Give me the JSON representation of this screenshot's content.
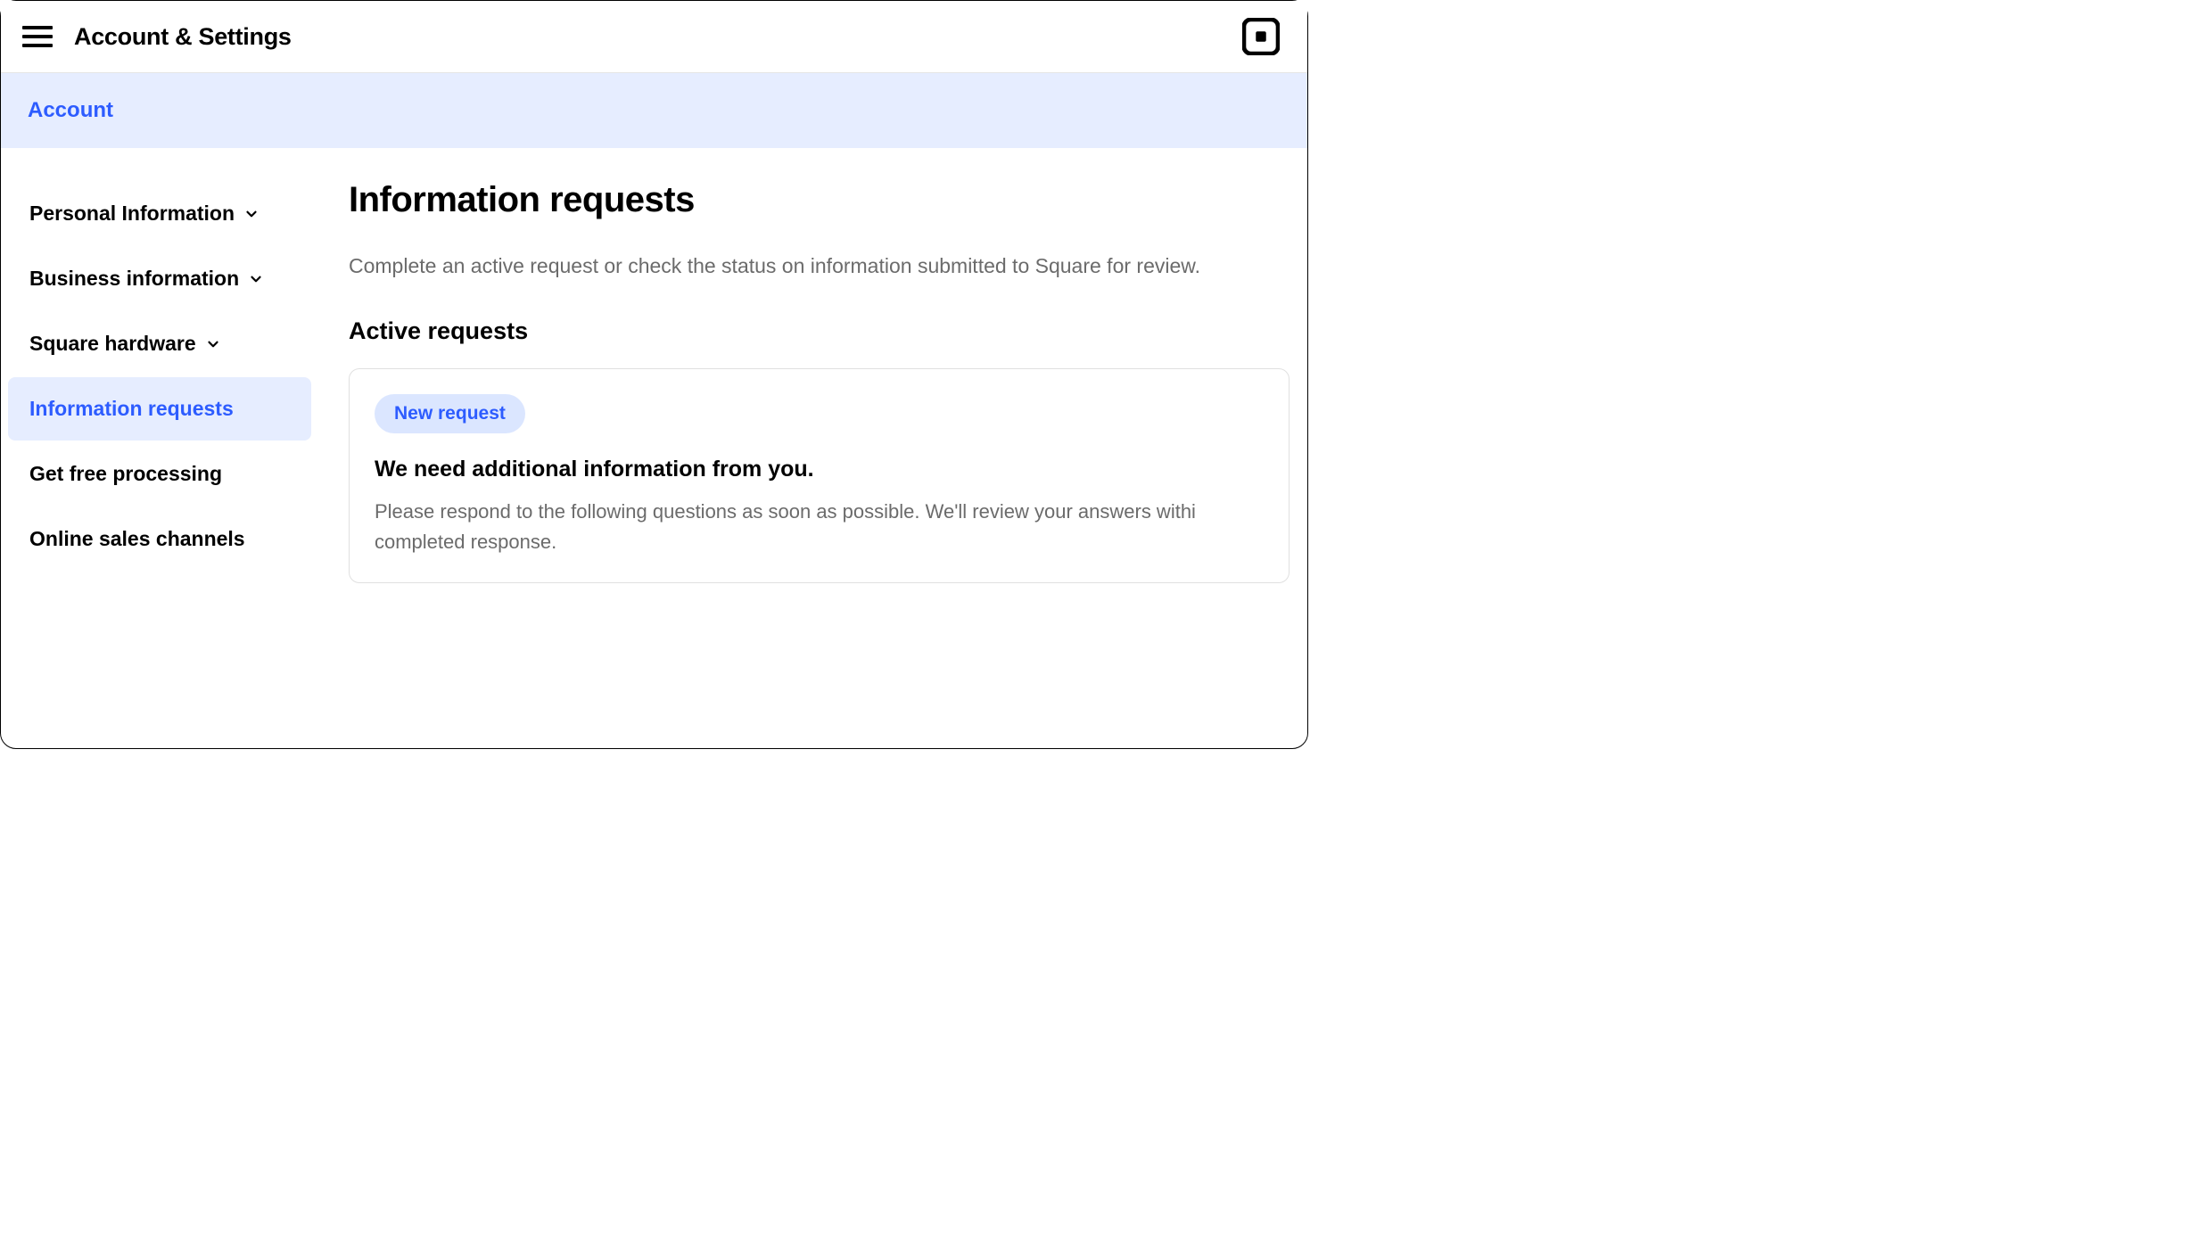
{
  "header": {
    "title": "Account & Settings"
  },
  "tabs": {
    "account": "Account"
  },
  "sidebar": {
    "items": [
      {
        "label": "Personal Information",
        "hasChevron": true
      },
      {
        "label": "Business information",
        "hasChevron": true
      },
      {
        "label": "Square hardware",
        "hasChevron": true
      },
      {
        "label": "Information requests",
        "hasChevron": false,
        "active": true
      },
      {
        "label": "Get free processing",
        "hasChevron": false
      },
      {
        "label": "Online sales channels",
        "hasChevron": false
      }
    ]
  },
  "main": {
    "title": "Information requests",
    "subtitle": "Complete an active request or check the status on information submitted to Square for review.",
    "activeRequestsHeading": "Active requests",
    "card": {
      "pill": "New request",
      "heading": "We need additional information from you.",
      "body": "Please respond to the following questions as soon as possible. We'll review your answers withi completed response."
    }
  }
}
